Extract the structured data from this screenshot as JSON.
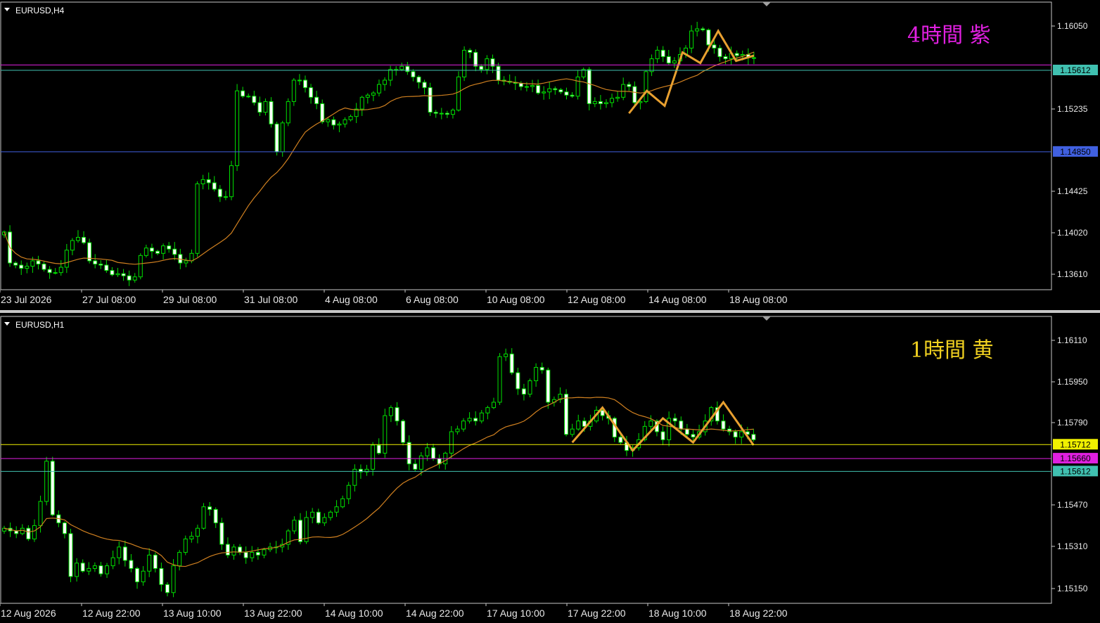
{
  "panels": [
    {
      "symbol_label": "EURUSD,H4",
      "caption": "4時間  紫",
      "caption_color": "#e020e0",
      "price_ticks": [
        "1.16050",
        "1.15235",
        "1.14425",
        "1.14020",
        "1.13610"
      ],
      "time_ticks": [
        "23 Jul 2026",
        "27 Jul 08:00",
        "29 Jul 08:00",
        "31 Jul 08:00",
        "4 Aug 08:00",
        "6 Aug 08:00",
        "10 Aug 08:00",
        "12 Aug 08:00",
        "14 Aug 08:00",
        "18 Aug 08:00"
      ],
      "levels": [
        {
          "price": 1.15662,
          "color": "#e020e0",
          "label": ""
        },
        {
          "price": 1.15612,
          "color": "#40c0b0",
          "label": "1.15612"
        },
        {
          "price": 1.1485,
          "color": "#4060e0",
          "label": "1.14850"
        }
      ]
    },
    {
      "symbol_label": "EURUSD,H1",
      "caption": "1時間  黄",
      "caption_color": "#f0d020",
      "price_ticks": [
        "1.16110",
        "1.15950",
        "1.15790",
        "1.15470",
        "1.15310",
        "1.15150"
      ],
      "time_ticks": [
        "12 Aug 2026",
        "12 Aug 22:00",
        "13 Aug 10:00",
        "13 Aug 22:00",
        "14 Aug 10:00",
        "14 Aug 22:00",
        "17 Aug 10:00",
        "17 Aug 22:00",
        "18 Aug 10:00",
        "18 Aug 22:00"
      ],
      "levels": [
        {
          "price": 1.15712,
          "color": "#f0f000",
          "label": "1.15712"
        },
        {
          "price": 1.1566,
          "color": "#e020e0",
          "label": "1.15660"
        },
        {
          "price": 1.15612,
          "color": "#40c0b0",
          "label": "1.15612"
        }
      ]
    }
  ],
  "chart_data": [
    {
      "type": "candlestick",
      "title": "EURUSD,H4",
      "ylim": [
        1.1356,
        1.1625
      ],
      "x_count": 119,
      "ma_color": "#d08020",
      "zigzag_color": "#e8a030",
      "zigzag": [
        [
          1.1521,
          1.1542,
          1.1528,
          1.1578,
          1.1568,
          1.1598,
          1.157,
          1.1575
        ]
      ],
      "closes": [
        1.141,
        1.1381,
        1.1379,
        1.1376,
        1.1378,
        1.1383,
        1.138,
        1.1375,
        1.1372,
        1.1372,
        1.1377,
        1.1393,
        1.1402,
        1.1405,
        1.14,
        1.1383,
        1.138,
        1.1379,
        1.1374,
        1.137,
        1.1371,
        1.1369,
        1.1365,
        1.1368,
        1.1388,
        1.1395,
        1.1392,
        1.139,
        1.1397,
        1.1394,
        1.1389,
        1.1381,
        1.1383,
        1.139,
        1.1455,
        1.1459,
        1.1456,
        1.145,
        1.1443,
        1.1443,
        1.1472,
        1.1542,
        1.1537,
        1.1537,
        1.1531,
        1.1522,
        1.1532,
        1.1511,
        1.1485,
        1.1512,
        1.1532,
        1.1552,
        1.1552,
        1.1545,
        1.1536,
        1.153,
        1.1513,
        1.1515,
        1.151,
        1.1511,
        1.1515,
        1.1518,
        1.1525,
        1.1536,
        1.1538,
        1.154,
        1.1548,
        1.1552,
        1.1562,
        1.1562,
        1.1565,
        1.156,
        1.1555,
        1.155,
        1.1545,
        1.1522,
        1.1521,
        1.1521,
        1.152,
        1.1524,
        1.1555,
        1.158,
        1.1578,
        1.1565,
        1.1562,
        1.1572,
        1.1565,
        1.1552,
        1.1551,
        1.155,
        1.1549,
        1.1546,
        1.1546,
        1.1547,
        1.154,
        1.1541,
        1.1544,
        1.1543,
        1.1541,
        1.1538,
        1.1537,
        1.1555,
        1.1562,
        1.153,
        1.1532,
        1.153,
        1.1531,
        1.1535,
        1.1536,
        1.1548,
        1.1546,
        1.1531,
        1.1532,
        1.156,
        1.1572,
        1.158,
        1.1574,
        1.1568,
        1.157,
        1.1576,
        1.1582,
        1.1598,
        1.16,
        1.1599,
        1.1585,
        1.1582,
        1.1574,
        1.1572,
        1.1577,
        1.1575,
        1.1576,
        1.1573,
        1.1573
      ]
    },
    {
      "type": "candlestick",
      "title": "EURUSD,H1",
      "ylim": [
        1.1512,
        1.1619
      ],
      "x_count": 125,
      "ma_color": "#d08020",
      "zigzag_color": "#e8a030",
      "zigzag": [
        [
          1.1572,
          1.1585,
          1.1569,
          1.1581,
          1.1572,
          1.1587,
          1.1571
        ]
      ],
      "closes": [
        1.154,
        1.1539,
        1.1538,
        1.154,
        1.1536,
        1.1541,
        1.155,
        1.1565,
        1.1545,
        1.1542,
        1.1538,
        1.1522,
        1.1527,
        1.1524,
        1.1525,
        1.1526,
        1.1523,
        1.1526,
        1.1529,
        1.1533,
        1.1528,
        1.1525,
        1.152,
        1.1524,
        1.153,
        1.1525,
        1.1519,
        1.1516,
        1.1526,
        1.1531,
        1.1536,
        1.1537,
        1.154,
        1.1548,
        1.1547,
        1.1542,
        1.1534,
        1.153,
        1.1533,
        1.1531,
        1.1529,
        1.1531,
        1.153,
        1.1532,
        1.1533,
        1.1533,
        1.1534,
        1.1539,
        1.1543,
        1.1535,
        1.1544,
        1.1546,
        1.1542,
        1.1544,
        1.1546,
        1.1548,
        1.1551,
        1.1556,
        1.1562,
        1.1561,
        1.1562,
        1.1571,
        1.1568,
        1.1582,
        1.1585,
        1.158,
        1.1572,
        1.1564,
        1.1562,
        1.1567,
        1.157,
        1.1566,
        1.1564,
        1.1568,
        1.1576,
        1.1577,
        1.158,
        1.1581,
        1.158,
        1.1583,
        1.1585,
        1.1587,
        1.1604,
        1.1605,
        1.1598,
        1.1592,
        1.159,
        1.1595,
        1.16,
        1.1599,
        1.1587,
        1.1588,
        1.159,
        1.1575,
        1.1577,
        1.158,
        1.1578,
        1.158,
        1.1584,
        1.1582,
        1.1581,
        1.1574,
        1.1572,
        1.1569,
        1.157,
        1.1573,
        1.1578,
        1.158,
        1.1576,
        1.1573,
        1.1581,
        1.158,
        1.1577,
        1.1575,
        1.1574,
        1.1576,
        1.158,
        1.1585,
        1.158,
        1.1577,
        1.1576,
        1.1574,
        1.1576,
        1.1575,
        1.1573
      ]
    }
  ]
}
